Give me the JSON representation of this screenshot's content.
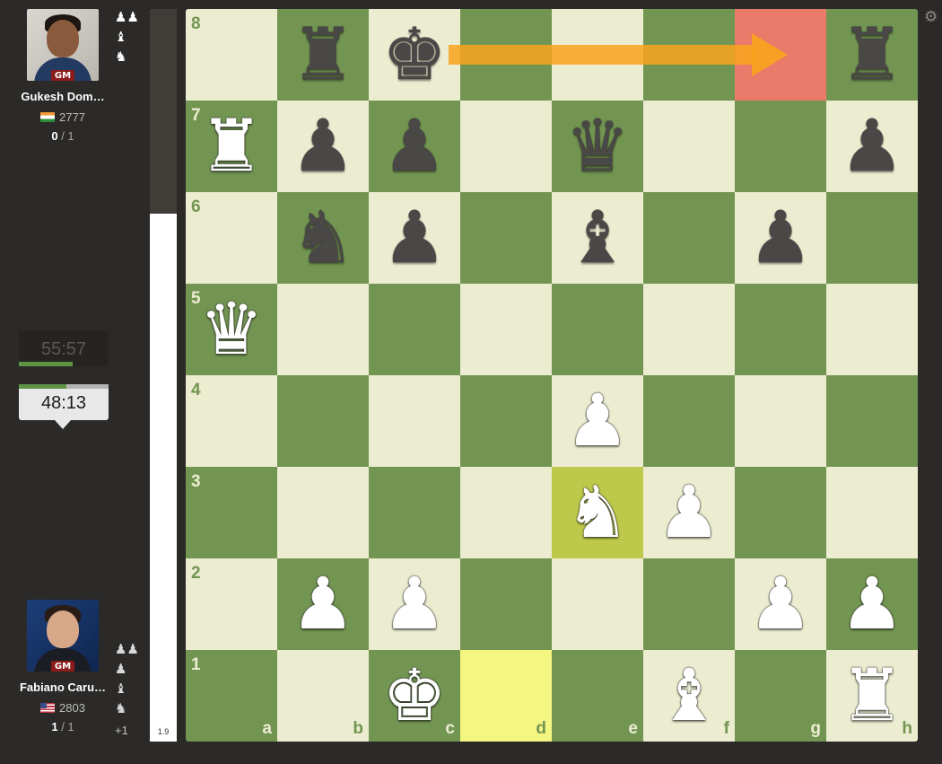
{
  "players": {
    "top": {
      "name": "Gukesh Dom…",
      "title": "GM",
      "rating": "2777",
      "flag": "india-flag",
      "score_main": "0",
      "score_rest": " / 1",
      "captured": [
        "♟♟",
        "♝",
        "♞"
      ],
      "clock": "55:57",
      "clock_fraction": 0.6
    },
    "bottom": {
      "name": "Fabiano Caru…",
      "title": "GM",
      "rating": "2803",
      "flag": "usa-flag",
      "score_main": "1",
      "score_rest": " / 1",
      "captured": [
        "♟♟",
        "♟",
        "♝",
        "♞"
      ],
      "material_advantage": "+1",
      "clock": "48:13",
      "clock_fraction": 0.53
    }
  },
  "eval": {
    "score": "1.9",
    "white_fraction": 0.72
  },
  "board": {
    "files": [
      "a",
      "b",
      "c",
      "d",
      "e",
      "f",
      "g",
      "h"
    ],
    "ranks": [
      "8",
      "7",
      "6",
      "5",
      "4",
      "3",
      "2",
      "1"
    ],
    "rows": [
      [
        "",
        "r",
        "k",
        "",
        "",
        "",
        "",
        "r"
      ],
      [
        "R",
        "p",
        "p",
        "",
        "q",
        "",
        "",
        "p"
      ],
      [
        "",
        "n",
        "p",
        "",
        "b",
        "",
        "p",
        ""
      ],
      [
        "Q",
        "",
        "",
        "",
        "",
        "",
        "",
        ""
      ],
      [
        "",
        "",
        "",
        "",
        "P",
        "",
        "",
        ""
      ],
      [
        "",
        "",
        "",
        "",
        "N",
        "P",
        "",
        ""
      ],
      [
        "",
        "P",
        "P",
        "",
        "",
        "",
        "P",
        "P"
      ],
      [
        "",
        "",
        "K",
        "",
        "",
        "B",
        "",
        "R"
      ]
    ],
    "highlights": {
      "last_move": [
        "e3"
      ],
      "yellow": [
        "d1"
      ],
      "red": [
        "g8"
      ]
    },
    "arrow": {
      "from": "c8",
      "to": "g8",
      "color": "#f9a41c"
    }
  },
  "colors": {
    "light_square": "#ebecd0",
    "dark_square": "#739552",
    "background": "#2b2a28"
  },
  "icons": {
    "settings": "gear-icon"
  }
}
